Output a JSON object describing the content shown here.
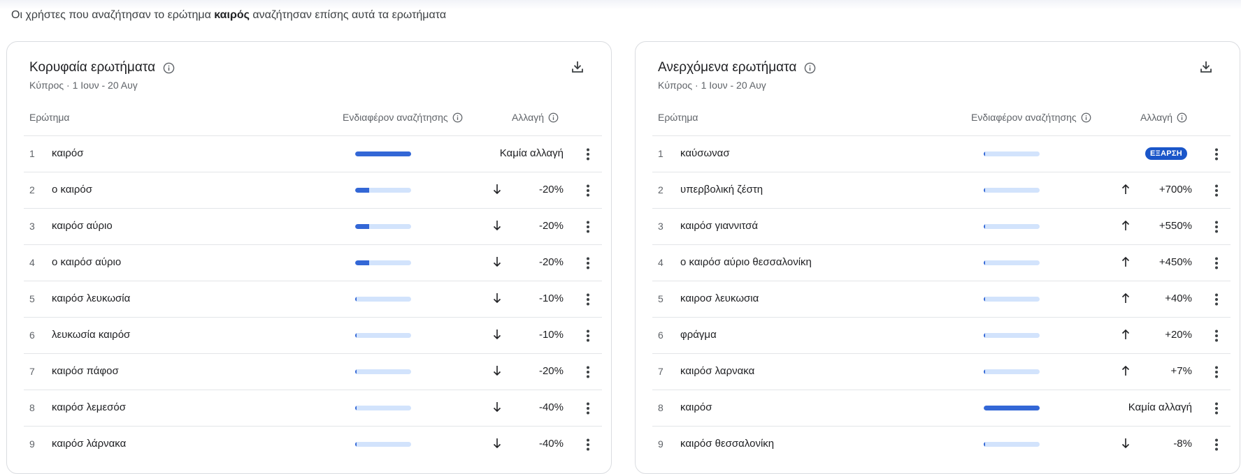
{
  "intro": {
    "before": "Οι χρήστες που αναζήτησαν το ερώτημα ",
    "keyword": "καιρός",
    "after": " αναζήτησαν επίσης αυτά τα ερωτήματα"
  },
  "headers": {
    "query": "Ερώτημα",
    "interest": "Ενδιαφέρον αναζήτησης",
    "change": "Αλλαγή"
  },
  "top": {
    "title": "Κορυφαία ερωτήματα",
    "subtitle": "Κύπρος · 1 Ιουν - 20 Αυγ",
    "rows": [
      {
        "num": "1",
        "term": "καιρόσ",
        "interest": 100,
        "dir": "none",
        "change": "Καμία αλλαγή"
      },
      {
        "num": "2",
        "term": "ο καιρόσ",
        "interest": 25,
        "dir": "down",
        "change": "-20%"
      },
      {
        "num": "3",
        "term": "καιρόσ αύριο",
        "interest": 25,
        "dir": "down",
        "change": "-20%"
      },
      {
        "num": "4",
        "term": "ο καιρόσ αύριο",
        "interest": 25,
        "dir": "down",
        "change": "-20%"
      },
      {
        "num": "5",
        "term": "καιρόσ λευκωσία",
        "interest": 2,
        "dir": "down",
        "change": "-10%"
      },
      {
        "num": "6",
        "term": "λευκωσία καιρόσ",
        "interest": 2,
        "dir": "down",
        "change": "-10%"
      },
      {
        "num": "7",
        "term": "καιρόσ πάφοσ",
        "interest": 2,
        "dir": "down",
        "change": "-20%"
      },
      {
        "num": "8",
        "term": "καιρόσ λεμεσόσ",
        "interest": 2,
        "dir": "down",
        "change": "-40%"
      },
      {
        "num": "9",
        "term": "καιρόσ λάρνακα",
        "interest": 2,
        "dir": "down",
        "change": "-40%"
      }
    ]
  },
  "rising": {
    "title": "Ανερχόμενα ερωτήματα",
    "subtitle": "Κύπρος · 1 Ιουν - 20 Αυγ",
    "rows": [
      {
        "num": "1",
        "term": "καύσωνασ",
        "interest": 2,
        "dir": "breakout",
        "change": "ΕΞΑΡΣΗ"
      },
      {
        "num": "2",
        "term": "υπερβολική ζέστη",
        "interest": 2,
        "dir": "up",
        "change": "+700%"
      },
      {
        "num": "3",
        "term": "καιρόσ γιαννιτσά",
        "interest": 2,
        "dir": "up",
        "change": "+550%"
      },
      {
        "num": "4",
        "term": "ο καιρόσ αύριο θεσσαλονίκη",
        "interest": 2,
        "dir": "up",
        "change": "+450%"
      },
      {
        "num": "5",
        "term": "καιροσ λευκωσια",
        "interest": 2,
        "dir": "up",
        "change": "+40%"
      },
      {
        "num": "6",
        "term": "φράγμα",
        "interest": 2,
        "dir": "up",
        "change": "+20%"
      },
      {
        "num": "7",
        "term": "καιρόσ λαρνακα",
        "interest": 2,
        "dir": "up",
        "change": "+7%"
      },
      {
        "num": "8",
        "term": "καιρόσ",
        "interest": 100,
        "dir": "none",
        "change": "Καμία αλλαγή"
      },
      {
        "num": "9",
        "term": "καιρόσ θεσσαλονίκη",
        "interest": 2,
        "dir": "down",
        "change": "-8%"
      }
    ]
  },
  "colors": {
    "bar_fill": "#3367d6",
    "bar_track": "#d2e3fc",
    "breakout_badge": "#1a56c9"
  },
  "icons": [
    "info-icon",
    "download-icon",
    "arrow-down-icon",
    "arrow-up-icon",
    "more-vert-icon"
  ]
}
